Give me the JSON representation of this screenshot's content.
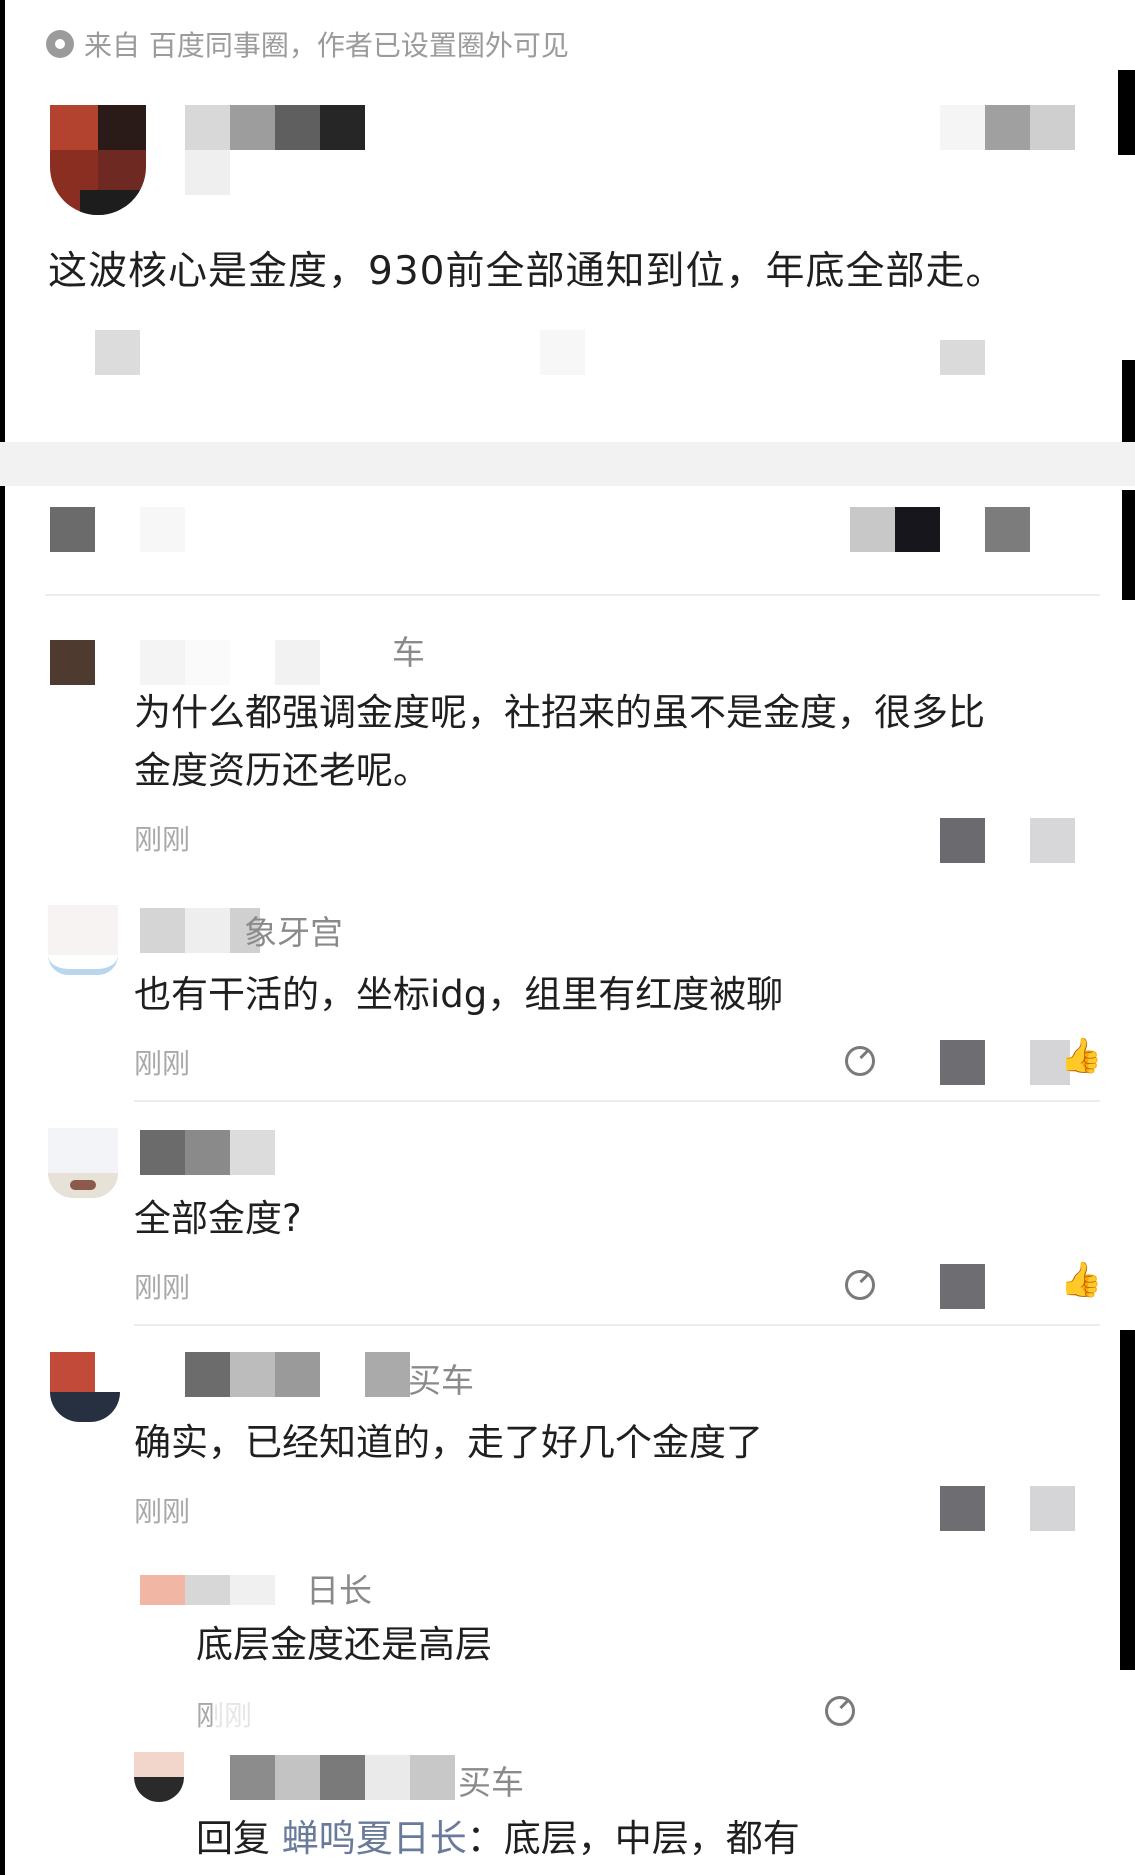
{
  "source": {
    "text": "来自 百度同事圈，作者已设置圈外可见"
  },
  "post": {
    "text": "这波核心是金度，930前全部通知到位，年底全部走。"
  },
  "comments": [
    {
      "name_fragment": "车",
      "text_line1": "为什么都强调金度呢，社招来的虽不是金度，很多比",
      "text_line2": "金度资历还老呢。",
      "time": "刚刚"
    },
    {
      "name_fragment": "象牙宫",
      "text": "也有干活的，坐标idg，组里有红度被聊",
      "time": "刚刚"
    },
    {
      "text": "全部金度?",
      "time": "刚刚"
    },
    {
      "name_fragment": "买车",
      "text": "确实，已经知道的，走了好几个金度了",
      "time": "刚刚",
      "replies": [
        {
          "name_fragment": "日长",
          "text": "底层金度还是高层",
          "time": "刚刚"
        },
        {
          "name_fragment": "买车",
          "reply_prefix": "回复",
          "reply_target": "蝉鸣夏日长",
          "reply_colon": "：",
          "text": "底层，中层，都有"
        }
      ]
    }
  ],
  "icons": {
    "like": "thumbs-up-icon",
    "share": "share-icon",
    "source": "circle-dot-icon"
  },
  "colors": {
    "text_primary": "#1f1f1f",
    "text_secondary": "#8a8a8a",
    "text_time": "#a8a8a8",
    "reply_target": "#6a7a9a"
  }
}
